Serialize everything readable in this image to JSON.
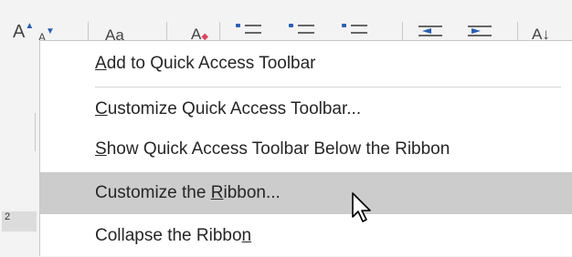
{
  "ribbon": {
    "grow_font": "A",
    "shrink_font": "A",
    "change_case": "Aa",
    "clear_formatting": "A",
    "sort": "A↓"
  },
  "left": {
    "ruler_number": "2"
  },
  "menu": {
    "items": [
      {
        "pre": "",
        "key": "A",
        "post": "dd to Quick Access Toolbar"
      },
      {
        "pre": "",
        "key": "C",
        "post": "ustomize Quick Access Toolbar..."
      },
      {
        "pre": "",
        "key": "S",
        "post": "how Quick Access Toolbar Below the Ribbon"
      },
      {
        "pre": "Customize the ",
        "key": "R",
        "post": "ibbon..."
      },
      {
        "pre": "Collapse the Ribbo",
        "key": "n",
        "post": ""
      }
    ],
    "highlight_color": "#cccccc"
  }
}
